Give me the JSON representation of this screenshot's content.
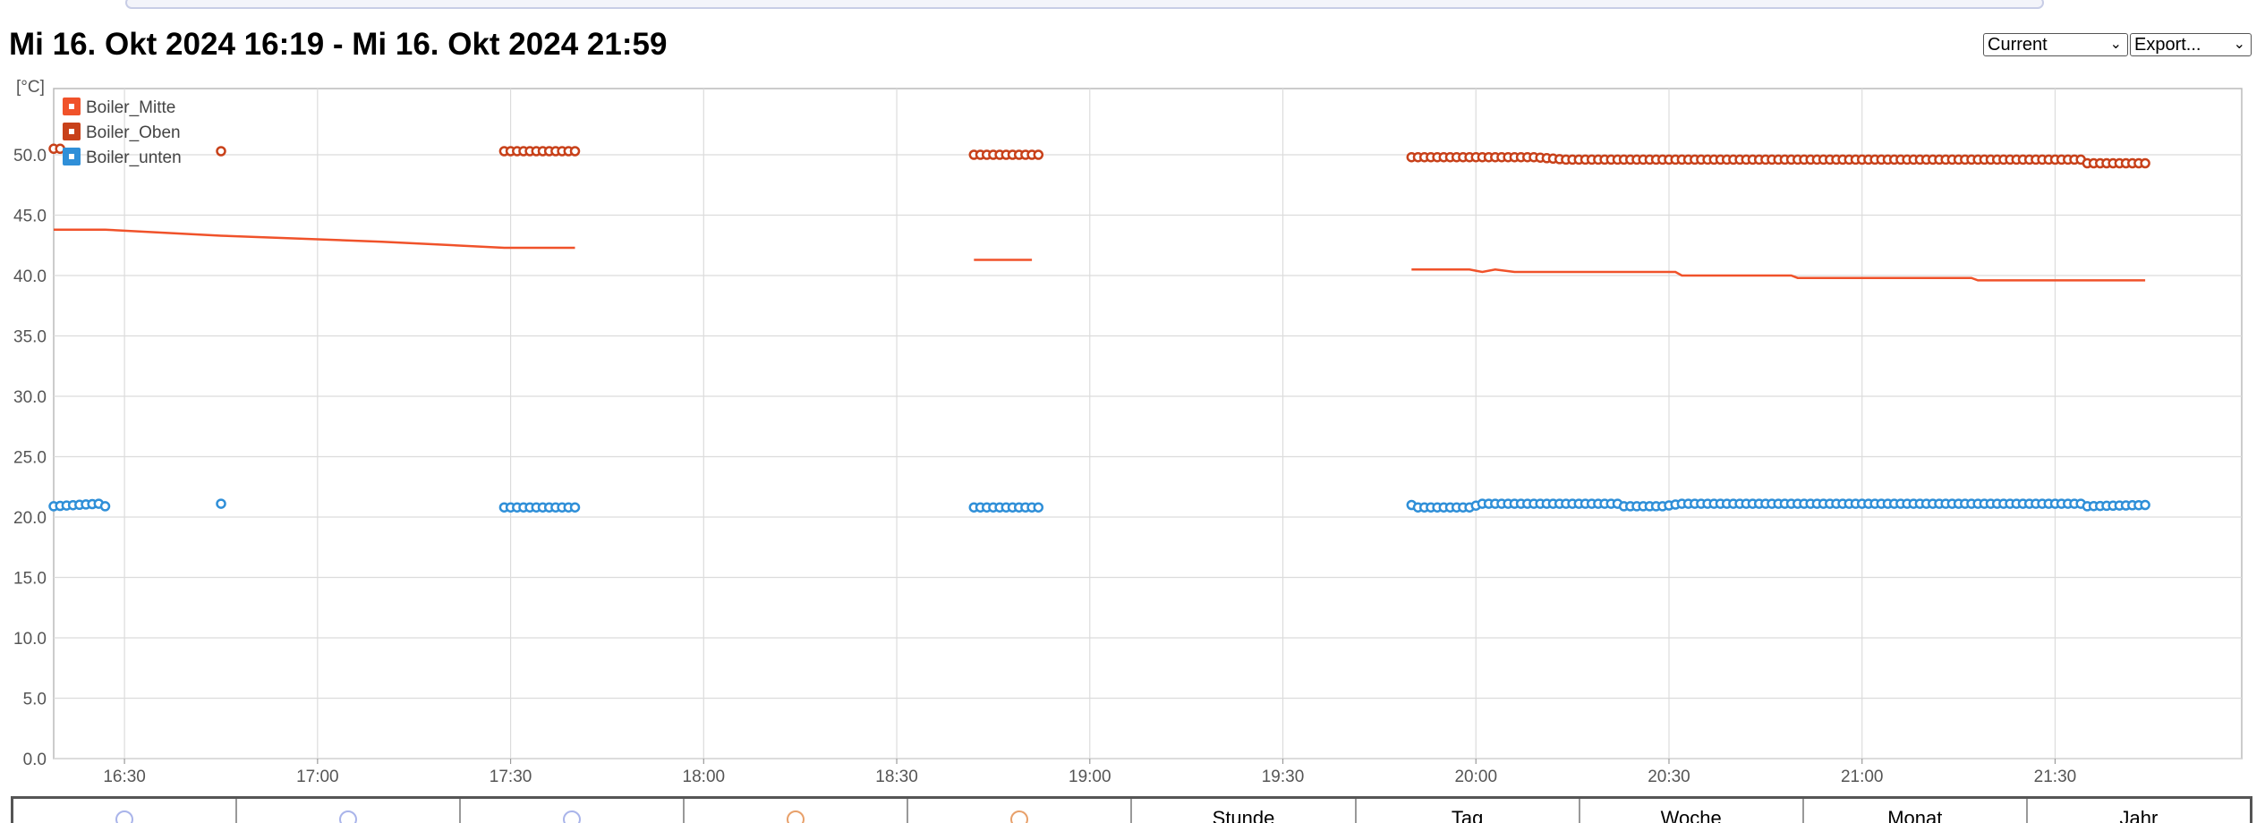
{
  "header": {
    "title": "Mi 16. Okt 2024 16:19 - Mi 16. Okt 2024 21:59",
    "range_select": "Current",
    "export_select": "Export..."
  },
  "bottom_tabs": {
    "cells": [
      {
        "kind": "radio",
        "color": "#a9b4ea"
      },
      {
        "kind": "radio",
        "color": "#a9b4ea"
      },
      {
        "kind": "radio",
        "color": "#a9b4ea"
      },
      {
        "kind": "radio",
        "color": "#e8a06a"
      },
      {
        "kind": "radio",
        "color": "#e8a06a"
      },
      {
        "kind": "label",
        "label": "Stunde"
      },
      {
        "kind": "label",
        "label": "Tag"
      },
      {
        "kind": "label",
        "label": "Woche"
      },
      {
        "kind": "label",
        "label": "Monat"
      },
      {
        "kind": "label",
        "label": "Jahr"
      }
    ]
  },
  "chart_data": {
    "type": "line",
    "title": "",
    "xlabel": "",
    "ylabel": "[°C]",
    "xlim": [
      "16:19",
      "21:59"
    ],
    "ylim": [
      0,
      60
    ],
    "y_ticks": [
      0,
      5,
      10,
      15,
      20,
      25,
      30,
      35,
      40,
      45,
      50
    ],
    "y_tick_labels": [
      "0.0",
      "5.0",
      "10.0",
      "15.0",
      "20.0",
      "25.0",
      "30.0",
      "35.0",
      "40.0",
      "45.0",
      "50.0"
    ],
    "x_ticks": [
      "16:30",
      "17:00",
      "17:30",
      "18:00",
      "18:30",
      "19:00",
      "19:30",
      "20:00",
      "20:30",
      "21:00",
      "21:30"
    ],
    "grid": true,
    "legend_position": "top-left",
    "series": [
      {
        "name": "Boiler_Mitte",
        "color": "#f0522a",
        "style": "line",
        "segments": [
          [
            [
              "16:19",
              43.8
            ],
            [
              "16:27",
              43.8
            ],
            [
              "16:45",
              43.3
            ],
            [
              "17:10",
              42.8
            ],
            [
              "17:29",
              42.3
            ],
            [
              "17:40",
              42.3
            ]
          ],
          [
            [
              "18:42",
              41.3
            ],
            [
              "18:51",
              41.3
            ]
          ],
          [
            [
              "19:50",
              40.5
            ],
            [
              "19:59",
              40.5
            ],
            [
              "20:01",
              40.3
            ],
            [
              "20:03",
              40.5
            ],
            [
              "20:06",
              40.3
            ],
            [
              "20:31",
              40.3
            ],
            [
              "20:32",
              40.0
            ],
            [
              "20:49",
              40.0
            ],
            [
              "20:50",
              39.8
            ],
            [
              "21:17",
              39.8
            ],
            [
              "21:18",
              39.6
            ],
            [
              "21:44",
              39.6
            ]
          ]
        ]
      },
      {
        "name": "Boiler_Oben",
        "color": "#c8411a",
        "style": "markers",
        "segments": [
          [
            [
              "16:19",
              50.5
            ],
            [
              "16:20",
              50.5
            ]
          ],
          [
            [
              "16:45",
              50.3
            ]
          ],
          [
            [
              "17:29",
              50.3
            ],
            [
              "17:40",
              50.3
            ]
          ],
          [
            [
              "18:42",
              50.0
            ],
            [
              "18:52",
              50.0
            ]
          ],
          [
            [
              "19:50",
              49.8
            ],
            [
              "20:09",
              49.8
            ],
            [
              "20:14",
              49.6
            ],
            [
              "20:20",
              49.6
            ],
            [
              "21:34",
              49.6
            ],
            [
              "21:35",
              49.3
            ],
            [
              "21:44",
              49.3
            ]
          ]
        ]
      },
      {
        "name": "Boiler_unten",
        "color": "#2f8fd8",
        "style": "markers",
        "segments": [
          [
            [
              "16:19",
              20.9
            ],
            [
              "16:26",
              21.1
            ],
            [
              "16:27",
              20.9
            ]
          ],
          [
            [
              "16:45",
              21.1
            ]
          ],
          [
            [
              "17:29",
              20.8
            ],
            [
              "17:40",
              20.8
            ]
          ],
          [
            [
              "18:42",
              20.8
            ],
            [
              "18:52",
              20.8
            ]
          ],
          [
            [
              "19:50",
              21.0
            ],
            [
              "19:51",
              20.8
            ],
            [
              "19:59",
              20.8
            ],
            [
              "20:01",
              21.1
            ],
            [
              "20:22",
              21.1
            ],
            [
              "20:23",
              20.9
            ],
            [
              "20:29",
              20.9
            ],
            [
              "20:32",
              21.1
            ],
            [
              "21:34",
              21.1
            ],
            [
              "21:35",
              20.9
            ],
            [
              "21:44",
              21.0
            ]
          ]
        ]
      }
    ]
  }
}
